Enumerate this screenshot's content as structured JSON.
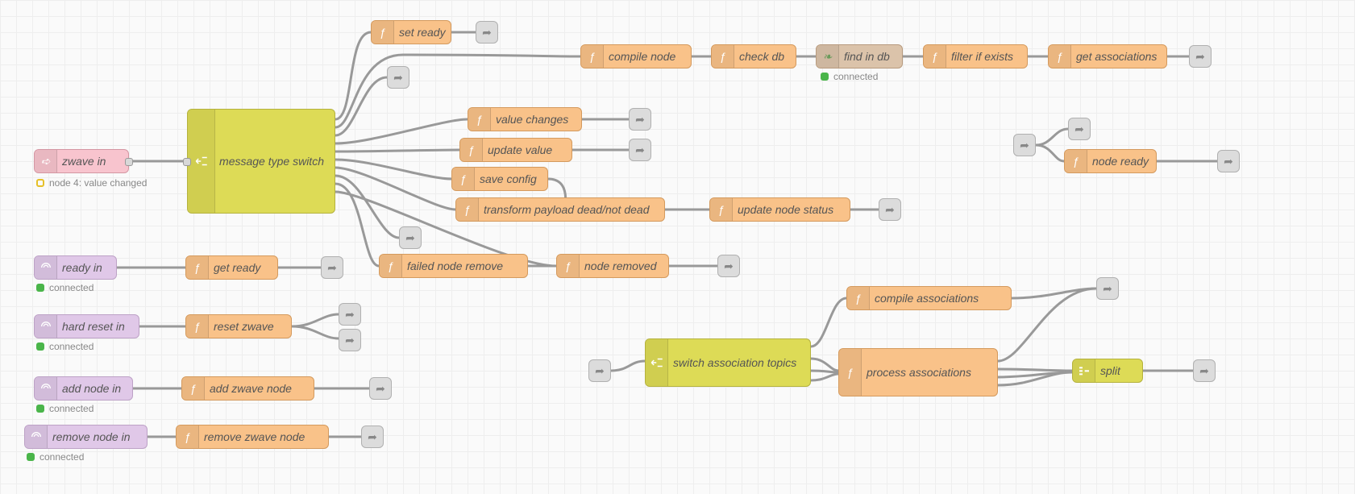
{
  "nodes": {
    "zwave_in": "zwave in",
    "ready_in": "ready in",
    "hard_reset_in": "hard reset in",
    "add_node_in": "add node in",
    "remove_node_in": "remove node in",
    "message_type_switch": "message type switch",
    "set_ready": "set ready",
    "compile_node": "compile node",
    "check_db": "check db",
    "find_in_db": "find in db",
    "filter_if_exists": "filter if exists",
    "get_associations": "get associations",
    "value_changes": "value changes",
    "update_value": "update value",
    "save_config": "save config",
    "transform_payload": "transform payload dead/not dead",
    "update_node_status": "update node status",
    "failed_node_remove": "failed node remove",
    "node_removed": "node removed",
    "get_ready": "get ready",
    "reset_zwave": "reset zwave",
    "add_zwave_node": "add zwave node",
    "remove_zwave_node": "remove zwave node",
    "switch_assoc_topics": "switch association topics",
    "compile_associations": "compile associations",
    "process_associations": "process associations",
    "split": "split",
    "node_ready": "node ready"
  },
  "status": {
    "zwave_in": "node 4: value changed",
    "ready_in": "connected",
    "hard_reset_in": "connected",
    "add_node_in": "connected",
    "remove_node_in": "connected",
    "find_in_db": "connected"
  },
  "colors": {
    "function": "#f9c289",
    "switch": "#dddb56",
    "link": "#dcdcdc",
    "input_pink": "#f8c4ce",
    "input_purple": "#e0c8e8",
    "db": "#dbc3aa"
  },
  "icons": {
    "function": "ƒ",
    "switch": "⇄",
    "arrow": "➪",
    "wifi": "𝄐",
    "db": "🍃",
    "split": "⠿",
    "debug": "➦"
  }
}
